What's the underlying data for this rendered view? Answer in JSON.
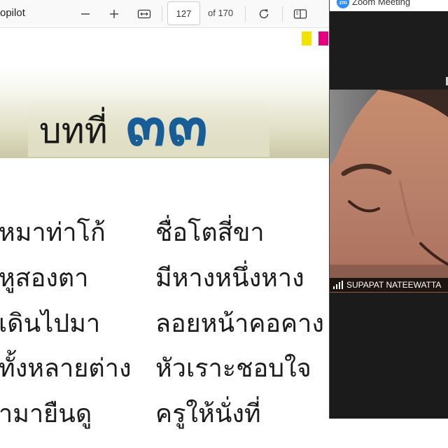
{
  "pdf_viewer": {
    "title_fragment": "opilot",
    "page_number": "127",
    "page_total": "of 170",
    "icons": {
      "zoom_out": "minus-icon",
      "zoom_in": "plus-icon",
      "fit_width": "fit-width-icon",
      "rotate": "rotate-icon",
      "page_view": "two-page-view-icon"
    }
  },
  "document": {
    "chapter_word": "บทที่",
    "chapter_number": "๓๓",
    "swatch_colors": [
      "#f5e100",
      "#e4007f"
    ],
    "poem": {
      "left_column": [
        "หมาท่าโก้",
        "หูสองตา",
        "เดินไปมา",
        "ทั้งหลายต่าง",
        "ามายืนดู"
      ],
      "right_column": [
        "ชื่อโตสี่ขา",
        "มีหางหนึ่งหาง",
        "ลอยหน้าคอคาง",
        "หัวเราะชอบใจ",
        "ครูให้นั่งที่"
      ]
    }
  },
  "zoom": {
    "window_title": "Zoom Meeting",
    "logo_text": "zm",
    "participant_name": "SUPAPAT NATEEWATTA",
    "signal_icon": "signal-strength-icon"
  }
}
